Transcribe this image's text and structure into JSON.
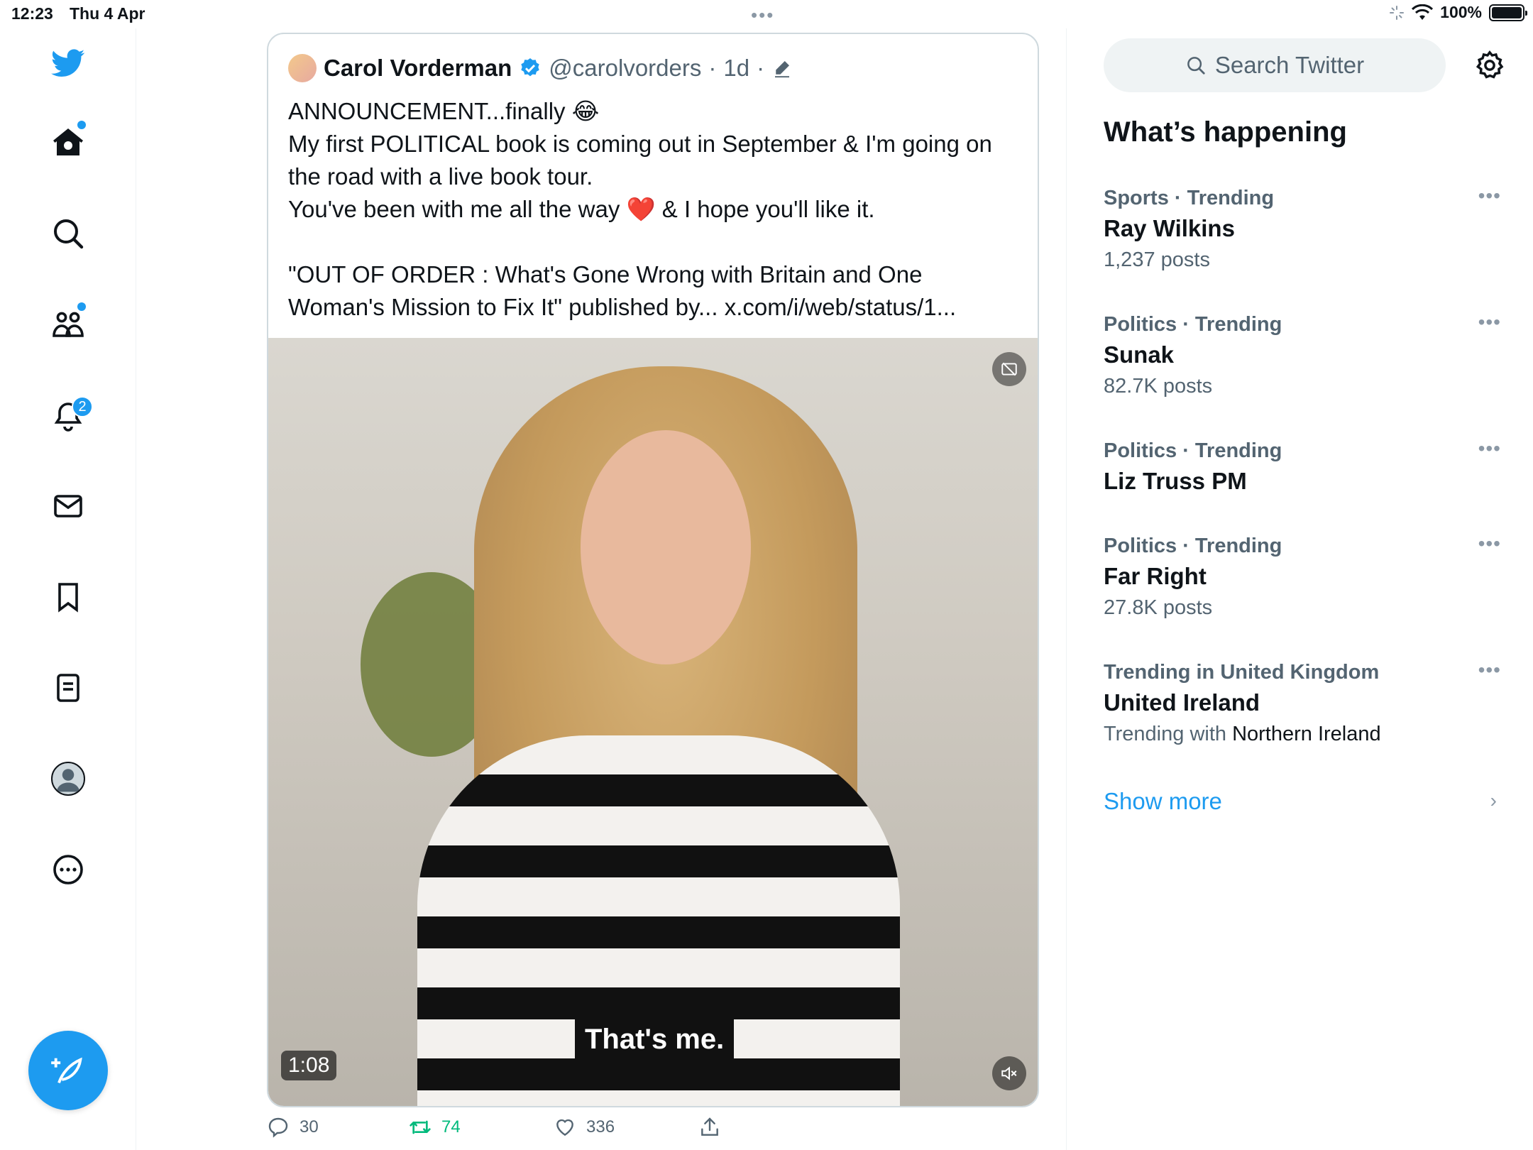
{
  "status_bar": {
    "time": "12:23",
    "date": "Thu 4 Apr",
    "battery": "100%",
    "battery_level": 1.0
  },
  "nav": {
    "notifications_badge": "2",
    "items": [
      "twitter-logo",
      "home-icon",
      "search-icon",
      "communities-icon",
      "notifications-icon",
      "messages-icon",
      "bookmarks-icon",
      "lists-icon",
      "profile-icon",
      "more-icon"
    ]
  },
  "tweet": {
    "name": "Carol Vorderman",
    "handle": "@carolvorders",
    "separator": "·",
    "age": "1d",
    "text_lines": [
      "ANNOUNCEMENT...finally 😂",
      "My first POLITICAL book is coming out in September & I'm going on the road with a live book tour.",
      "You've been with me all the way ❤️ & I hope you'll like it.",
      "",
      "\"OUT OF ORDER : What's Gone Wrong with Britain and One Woman's Mission to Fix It\" published by... x.com/i/web/status/1..."
    ],
    "video": {
      "caption": "That's me.",
      "duration": "1:08"
    },
    "actions": {
      "replies": "30",
      "retweets": "74",
      "likes": "336"
    }
  },
  "sidebar": {
    "search_placeholder": "Search Twitter",
    "section_title": "What’s happening",
    "trends": [
      {
        "meta": "Sports · Trending",
        "name": "Ray Wilkins",
        "sub": "1,237 posts"
      },
      {
        "meta": "Politics · Trending",
        "name": "Sunak",
        "sub": "82.7K posts"
      },
      {
        "meta": "Politics · Trending",
        "name": "Liz Truss PM",
        "sub": ""
      },
      {
        "meta": "Politics · Trending",
        "name": "Far Right",
        "sub": "27.8K posts"
      },
      {
        "meta": "Trending in United Kingdom",
        "name": "United Ireland",
        "sub_prefix": "Trending with",
        "sub_strong": "Northern Ireland"
      }
    ],
    "show_more": "Show more"
  },
  "colors": {
    "accent": "#1d9bf0",
    "retweet_green": "#00ba7c",
    "text_secondary": "#536471"
  }
}
